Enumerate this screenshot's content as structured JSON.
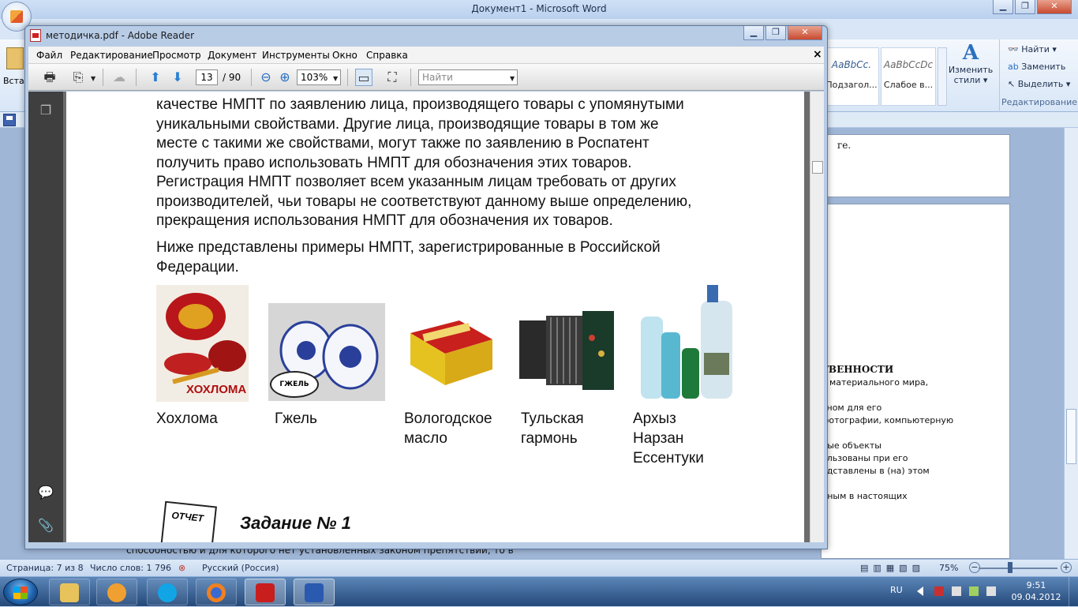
{
  "word": {
    "title": "Документ1 - Microsoft Word",
    "ribbon": {
      "left_label": "Вста",
      "styles": [
        {
          "sample": "AaBbCc.",
          "name": "Подзагол..."
        },
        {
          "sample": "AaBbCcDc",
          "name": "Слабое в..."
        }
      ],
      "change_styles_line1": "Изменить",
      "change_styles_line2": "стили",
      "edit_group": {
        "find": "Найти",
        "replace": "Заменить",
        "select": "Выделить",
        "label": "Редактирование"
      }
    },
    "doc_lines": {
      "p1_fragment": "ге.",
      "heading_fragment": "ТВЕННОСТИ",
      "lines": [
        "в материального мира,",
        "чном для его",
        "фотографии, компьютерную",
        "ные объекты",
        "ользованы при его",
        "едставлены в (на) этом",
        "нным в настоящих"
      ],
      "bottom_line": "способностью и для которого нет установленных законом препятствий, то в"
    },
    "status": {
      "page": "Страница: 7 из 8",
      "words": "Число слов: 1 796",
      "language": "Русский (Россия)",
      "zoom": "75%"
    }
  },
  "reader": {
    "title": "методичка.pdf - Adobe Reader",
    "menu": [
      "Файл",
      "Редактирование",
      "Просмотр",
      "Документ",
      "Инструменты",
      "Окно",
      "Справка"
    ],
    "toolbar": {
      "page_current": "13",
      "page_total": "/ 90",
      "zoom": "103%",
      "find_placeholder": "Найти"
    },
    "page": {
      "para1": [
        "качестве НМПТ по заявлению лица, производящего товары с упомянутыми",
        "уникальными свойствами. Другие лица, производящие товары в том же",
        "месте с такими же свойствами, могут также по заявлению в Роспатент",
        "получить право использовать НМПТ для обозначения этих товаров.",
        "Регистрация НМПТ позволяет всем указанным лицам требовать от других",
        "производителей, чьи товары не соответствуют данному выше определению,",
        "прекращения использования НМПТ для обозначения их товаров."
      ],
      "para2": [
        "Ниже представлены примеры НМПТ, зарегистрированные в Российской",
        "Федерации."
      ],
      "examples": [
        {
          "caption": [
            "Хохлома"
          ],
          "logo": "ХОХЛОМА"
        },
        {
          "caption": [
            "Гжель"
          ],
          "logo": "ГЖЕЛЬ"
        },
        {
          "caption": [
            "Вологодское",
            "масло"
          ],
          "logo": ""
        },
        {
          "caption": [
            "Тульская",
            "гармонь"
          ],
          "logo": ""
        },
        {
          "caption": [
            "Архыз",
            "Нарзан",
            "Ессентуки"
          ],
          "logo": ""
        }
      ],
      "report_label": "ОТЧЕТ",
      "task_heading": "Задание № 1"
    }
  },
  "taskbar": {
    "language": "RU",
    "time": "9:51",
    "date": "09.04.2012"
  }
}
